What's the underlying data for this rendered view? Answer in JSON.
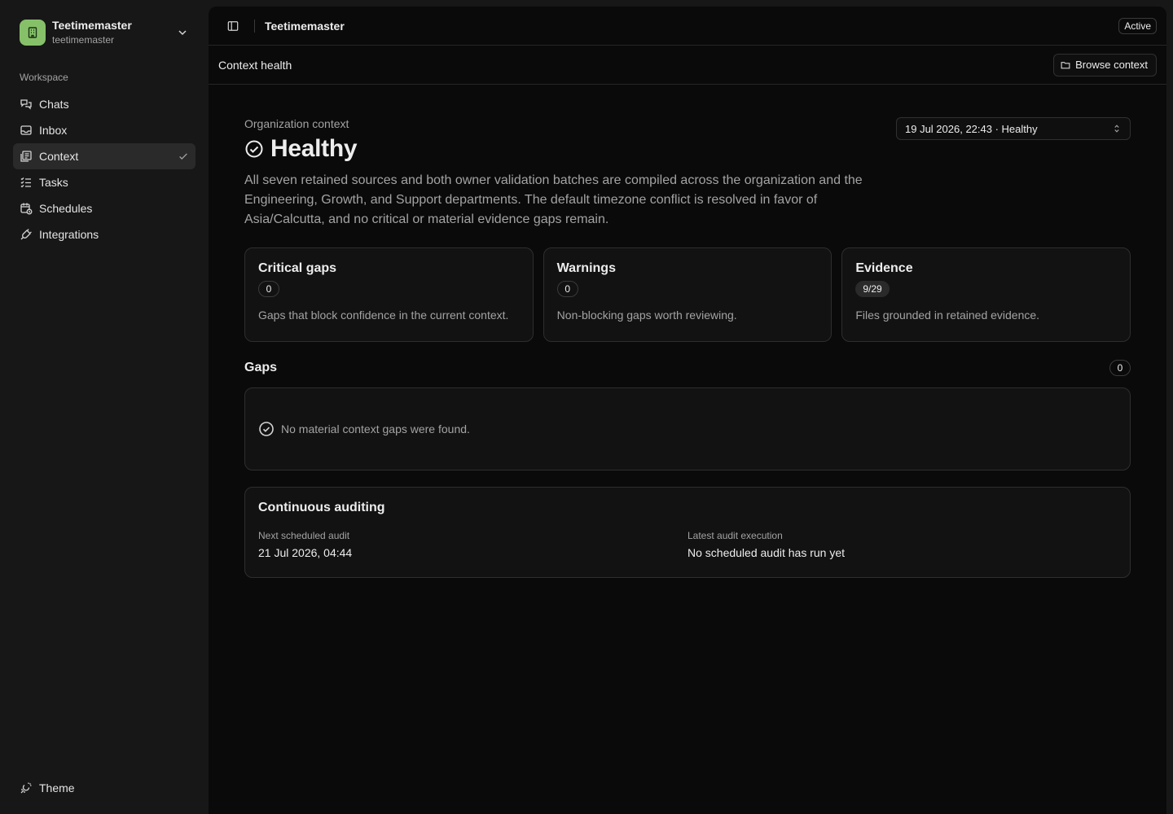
{
  "workspace": {
    "name": "Teetimemaster",
    "slug": "teetimemaster"
  },
  "sidebar": {
    "section_label": "Workspace",
    "items": [
      {
        "label": "Chats",
        "icon": "chats-icon"
      },
      {
        "label": "Inbox",
        "icon": "inbox-icon"
      },
      {
        "label": "Context",
        "icon": "context-icon",
        "active": true
      },
      {
        "label": "Tasks",
        "icon": "tasks-icon"
      },
      {
        "label": "Schedules",
        "icon": "schedules-icon"
      },
      {
        "label": "Integrations",
        "icon": "integrations-icon"
      }
    ],
    "theme_label": "Theme"
  },
  "topbar": {
    "title": "Teetimemaster",
    "status": "Active"
  },
  "subbar": {
    "title": "Context health",
    "browse_label": "Browse context"
  },
  "overview": {
    "label": "Organization context",
    "status": "Healthy",
    "summary": "All seven retained sources and both owner validation batches are compiled across the organization and the Engineering, Growth, and Support departments. The default timezone conflict is resolved in favor of Asia/Calcutta, and no critical or material evidence gaps remain.",
    "snapshot": "19 Jul 2026, 22:43 · Healthy"
  },
  "cards": [
    {
      "title": "Critical gaps",
      "value": "0",
      "desc": "Gaps that block confidence in the current context."
    },
    {
      "title": "Warnings",
      "value": "0",
      "desc": "Non-blocking gaps worth reviewing."
    },
    {
      "title": "Evidence",
      "value": "9/29",
      "desc": "Files grounded in retained evidence."
    }
  ],
  "gaps": {
    "title": "Gaps",
    "count": "0",
    "empty": "No material context gaps were found."
  },
  "auditing": {
    "title": "Continuous auditing",
    "next_label": "Next scheduled audit",
    "next_value": "21 Jul 2026, 04:44",
    "latest_label": "Latest audit execution",
    "latest_value": "No scheduled audit has run yet"
  },
  "colors": {
    "brand": "#86c16a",
    "background": "#0a0a0a",
    "sidebar": "#171717"
  }
}
